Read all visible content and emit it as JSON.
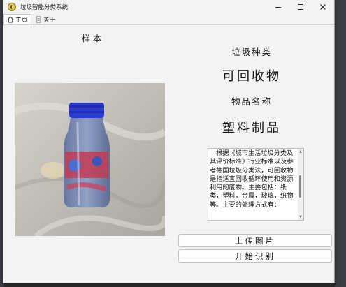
{
  "window": {
    "title": "垃圾智能分类系统",
    "controls": {
      "minimize_icon": "minimize-icon",
      "maximize_icon": "maximize-icon",
      "close_icon": "close-icon"
    }
  },
  "tabs": [
    {
      "label": "主页",
      "icon": "home-icon",
      "active": true
    },
    {
      "label": "关于",
      "icon": "document-icon",
      "active": false
    }
  ],
  "main": {
    "sample_label": "样本",
    "photo_subject": "plastic bottle with blue cap",
    "category_title": "垃圾种类",
    "category_value": "可回收物",
    "item_title": "物品名称",
    "item_value": "塑料制品",
    "description": "根据《城市生活垃圾分类及其评价标准》行业标准以及参考德国垃圾分类法，可回收物是指适宜回收循环使用和资源利用的废物。主要包括：纸类，塑料，金属，玻璃，织物等。主要的处理方式有：",
    "upload_button": "上传图片",
    "recognize_button": "开始识别"
  },
  "colors": {
    "window_bg": "#f3f3f3",
    "bottle_cap": "#2a3bd6",
    "desktop_bg": "#3a3d41"
  }
}
